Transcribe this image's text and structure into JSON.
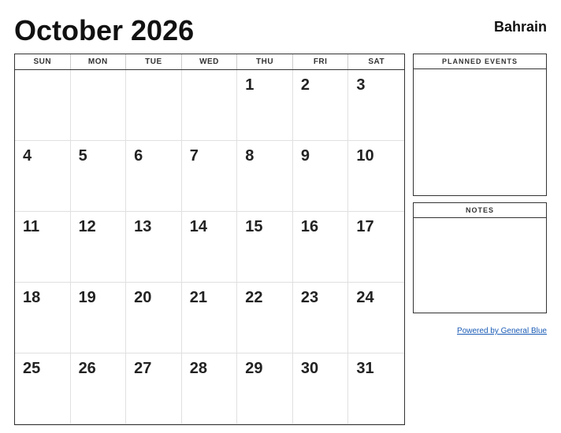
{
  "header": {
    "title": "October 2026",
    "country": "Bahrain"
  },
  "calendar": {
    "day_headers": [
      "SUN",
      "MON",
      "TUE",
      "WED",
      "THU",
      "FRI",
      "SAT"
    ],
    "weeks": [
      [
        "",
        "",
        "",
        "",
        "1",
        "2",
        "3"
      ],
      [
        "4",
        "5",
        "6",
        "7",
        "8",
        "9",
        "10"
      ],
      [
        "11",
        "12",
        "13",
        "14",
        "15",
        "16",
        "17"
      ],
      [
        "18",
        "19",
        "20",
        "21",
        "22",
        "23",
        "24"
      ],
      [
        "25",
        "26",
        "27",
        "28",
        "29",
        "30",
        "31"
      ]
    ]
  },
  "sidebar": {
    "planned_events_label": "PLANNED EVENTS",
    "notes_label": "NOTES"
  },
  "footer": {
    "powered_by": "Powered by General Blue",
    "powered_by_url": "#"
  }
}
